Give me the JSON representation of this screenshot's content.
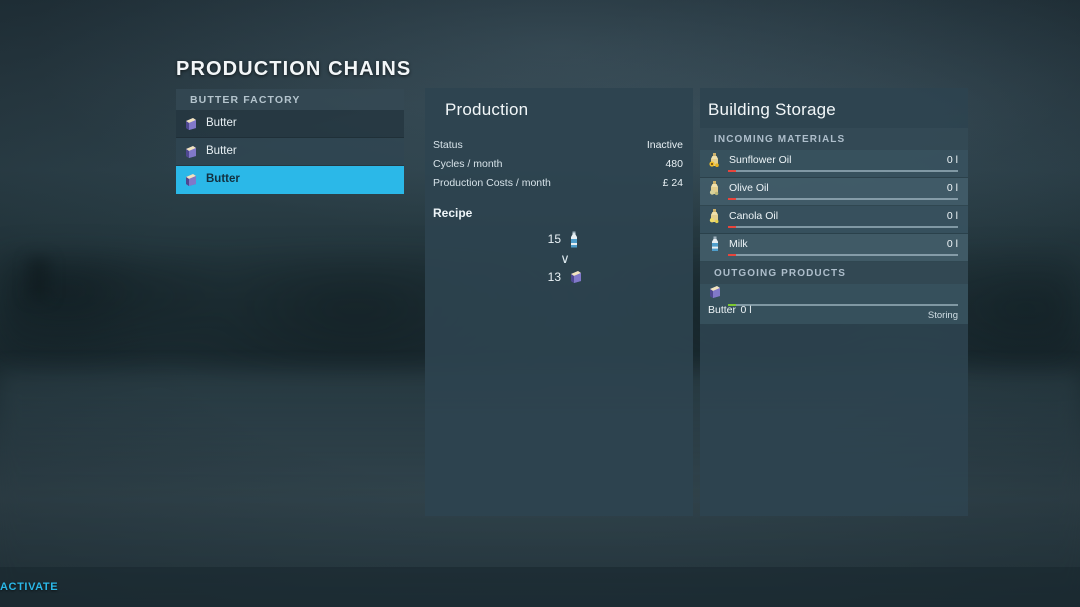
{
  "page": {
    "title": "PRODUCTION CHAINS"
  },
  "chain_list": {
    "group_header": "BUTTER FACTORY",
    "items": [
      {
        "label": "Butter",
        "icon": "butter-icon",
        "selected": false
      },
      {
        "label": "Butter",
        "icon": "butter-icon",
        "selected": false
      },
      {
        "label": "Butter",
        "icon": "butter-icon",
        "selected": true
      }
    ]
  },
  "production": {
    "title": "Production",
    "stats": [
      {
        "label": "Status",
        "value": "Inactive"
      },
      {
        "label": "Cycles / month",
        "value": "480"
      },
      {
        "label": "Production Costs / month",
        "value": "£ 24"
      }
    ],
    "recipe_title": "Recipe",
    "recipe": {
      "input": {
        "quantity": "15",
        "icon": "milk-bottle-icon"
      },
      "arrow": "∨",
      "output": {
        "quantity": "13",
        "icon": "butter-icon"
      }
    }
  },
  "storage": {
    "title": "Building Storage",
    "incoming_header": "INCOMING MATERIALS",
    "incoming": [
      {
        "name": "Sunflower Oil",
        "amount": "0 l",
        "icon": "sunflower-oil-icon",
        "fill": "red"
      },
      {
        "name": "Olive Oil",
        "amount": "0 l",
        "icon": "olive-oil-icon",
        "fill": "red"
      },
      {
        "name": "Canola Oil",
        "amount": "0 l",
        "icon": "canola-oil-icon",
        "fill": "red"
      },
      {
        "name": "Milk",
        "amount": "0 l",
        "icon": "milk-bottle-icon",
        "fill": "red"
      }
    ],
    "outgoing_header": "OUTGOING PRODUCTS",
    "outgoing": [
      {
        "name": "Butter",
        "amount": "0 l",
        "icon": "butter-icon",
        "fill": "green",
        "status": "Storing"
      }
    ]
  },
  "footer": {
    "activate_label": "ACTIVATE"
  },
  "colors": {
    "accent": "#2bb8e8",
    "panel": "#2d4450",
    "background": "#22333d",
    "fill_empty": "#e8453c",
    "fill_ok": "#7dc832"
  }
}
